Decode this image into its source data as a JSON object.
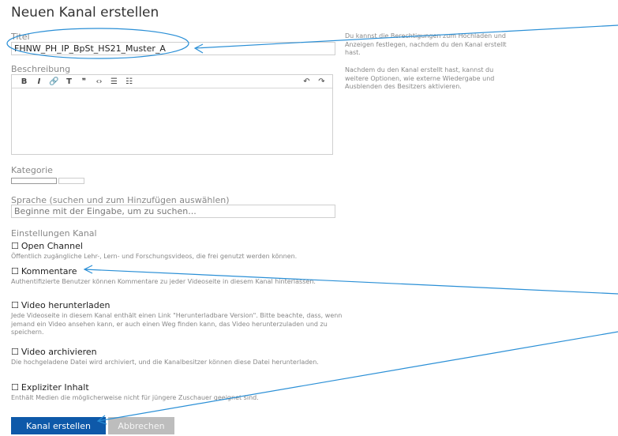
{
  "page": {
    "title": "Neuen Kanal erstellen"
  },
  "form": {
    "title_label": "Titel",
    "title_value": "FHNW_PH_IP_BpSt_HS21_Muster_A",
    "description_label": "Beschreibung",
    "toolbar": {
      "bold": "B",
      "italic": "I",
      "link": "🔗",
      "heading": "T",
      "quote": "❞",
      "code": "‹›",
      "bullet_list": "☰",
      "numbered_list": "☷",
      "undo": "↶",
      "redo": "↷"
    },
    "category_label": "Kategorie",
    "language_label": "Sprache (suchen und zum Hinzufügen auswählen)",
    "language_placeholder": "Beginne mit der Eingabe, um zu suchen...",
    "settings_label": "Einstellungen Kanal",
    "options": [
      {
        "box": "☐",
        "label": "Open Channel",
        "desc": "Öffentlich zugängliche Lehr-, Lern- und Forschungsvideos, die frei genutzt werden können."
      },
      {
        "box": "☐",
        "label": "Kommentare",
        "desc": "Authentifizierte Benutzer können Kommentare zu jeder Videoseite in diesem Kanal hinterlassen."
      },
      {
        "box": "☐",
        "label": "Video herunterladen",
        "desc": "Jede Videoseite in diesem Kanal enthält einen Link \"Herunterladbare Version\". Bitte beachte, dass, wenn jemand ein Video ansehen kann, er auch einen Weg finden kann, das Video herunterzuladen und zu speichern."
      },
      {
        "box": "☐",
        "label": "Video archivieren",
        "desc": "Die hochgeladene Datei wird archiviert, und die Kanalbesitzer können diese Datei herunterladen."
      },
      {
        "box": "☐",
        "label": "Expliziter Inhalt",
        "desc": "Enthält Medien die möglicherweise nicht für jüngere Zuschauer geeignet sind."
      }
    ],
    "submit_label": "Kanal erstellen",
    "cancel_label": "Abbrechen"
  },
  "help": {
    "p1": "Du kannst die Berechtigungen zum Hochladen und Anzeigen festlegen, nachdem du den Kanal erstellt hast.",
    "p2": "Nachdem du den Kanal erstellt hast, kannst du weitere Optionen, wie externe Wiedergabe und Ausblenden des Besitzers aktivieren."
  },
  "colors": {
    "primary": "#0e59a9",
    "annotation": "#2a8fd6"
  }
}
